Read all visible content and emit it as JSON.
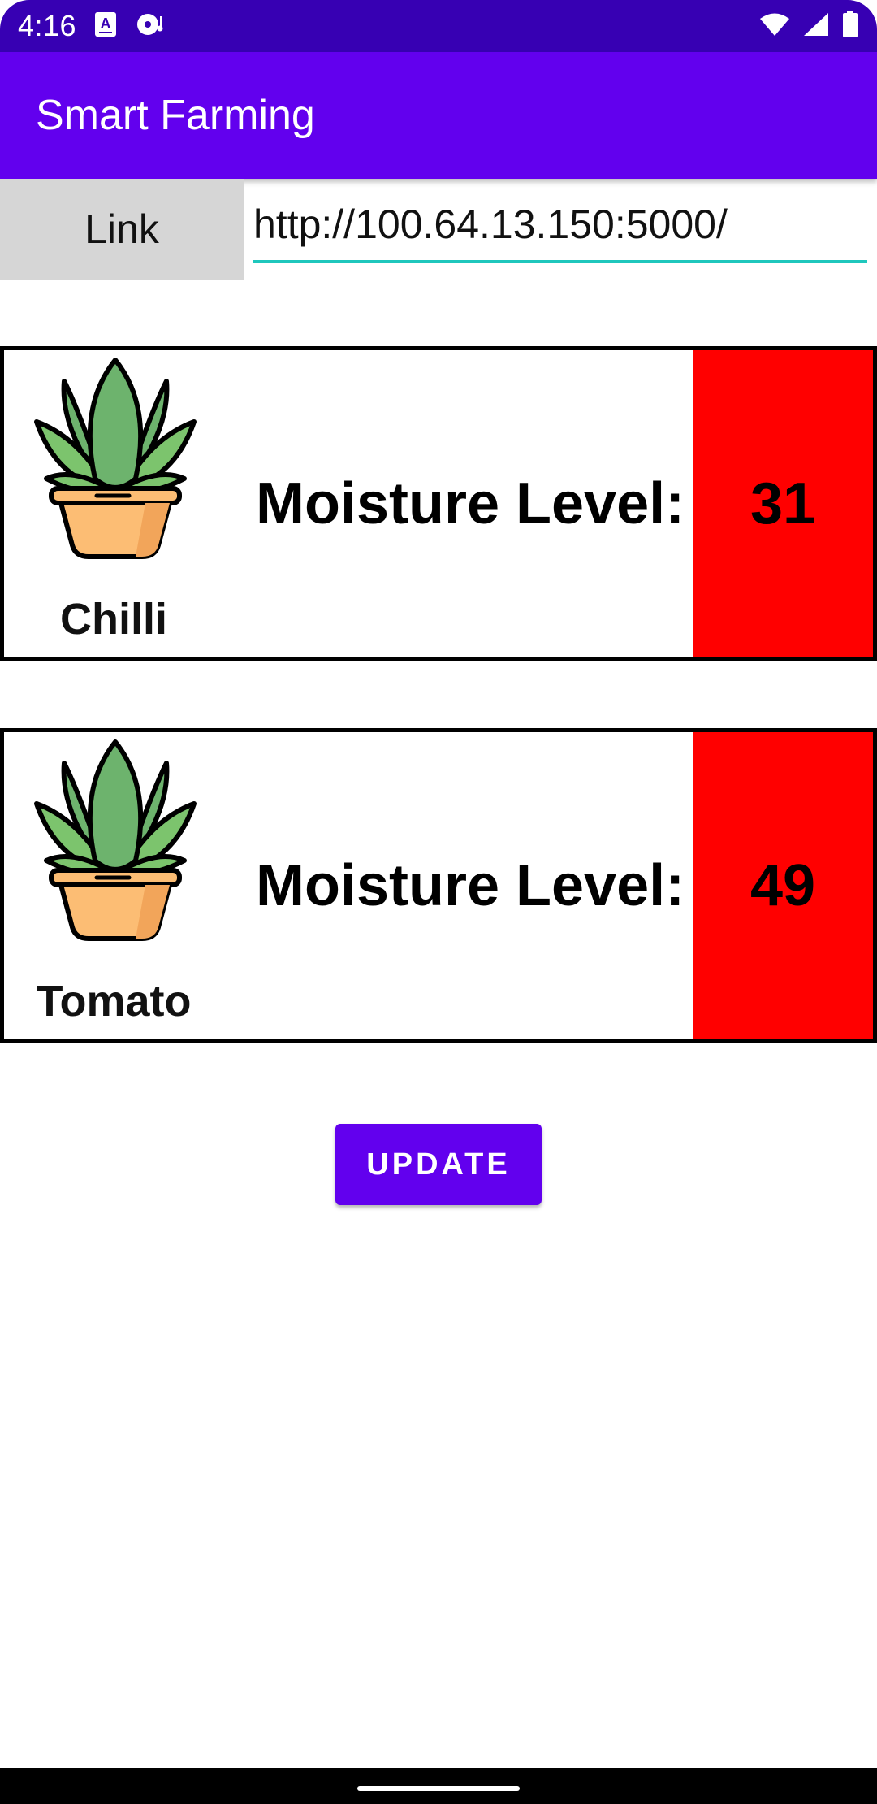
{
  "status_bar": {
    "time": "4:16",
    "notification_icons": [
      "keyboard-a-icon",
      "media-disc-icon"
    ],
    "system_icons": [
      "wifi-icon",
      "cell-signal-icon",
      "battery-icon"
    ]
  },
  "app_bar": {
    "title": "Smart Farming"
  },
  "link_row": {
    "label": "Link",
    "url_value": "http://100.64.13.150:5000/"
  },
  "plants": [
    {
      "name": "Chilli",
      "moisture_label": "Moisture Level:",
      "moisture_value": "31",
      "status_color": "#ff0000"
    },
    {
      "name": "Tomato",
      "moisture_label": "Moisture Level:",
      "moisture_value": "49",
      "status_color": "#ff0000"
    }
  ],
  "update_button": {
    "label": "UPDATE"
  },
  "colors": {
    "primary": "#6200EE",
    "primary_dark": "#3700B3",
    "accent_underline": "#1fc7bd",
    "link_label_bg": "#d6d6d6"
  }
}
